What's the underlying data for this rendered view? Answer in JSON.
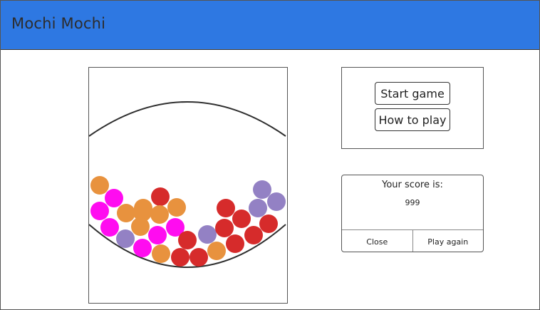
{
  "app": {
    "title": "Mochi Mochi"
  },
  "menu": {
    "start_label": "Start game",
    "how_label": "How to play"
  },
  "score": {
    "title": "Your score is:",
    "value": "999",
    "close_label": "Close",
    "play_again_label": "Play again"
  },
  "game": {
    "colors": {
      "orange": "#e8923e",
      "magenta": "#ff0cf0",
      "red": "#d62b2b",
      "purple": "#9381c4"
    }
  }
}
